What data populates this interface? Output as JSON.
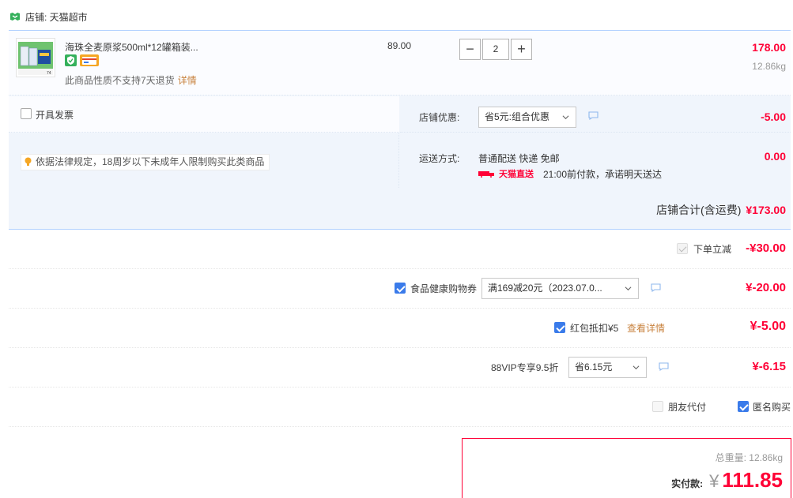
{
  "store": {
    "label": "店铺: 天猫超市"
  },
  "item": {
    "title": "海珠全麦原浆500ml*12罐箱装...",
    "unit_price": "89.00",
    "quantity": "2",
    "qty_minus": "−",
    "qty_plus": "+",
    "line_total": "178.00",
    "weight": "12.86kg",
    "return_note": "此商品性质不支持7天退货",
    "detail_link": "详情",
    "thumb_badge": "74"
  },
  "invoice": {
    "label": "开具发票"
  },
  "law_note": "依据法律规定，18周岁以下未成年人限制购买此类商品",
  "store_promo": {
    "label": "店铺优惠:",
    "selected": "省5元:组合优惠",
    "amount": "-5.00"
  },
  "shipping": {
    "label": "运送方式:",
    "method": "普通配送 快递 免邮",
    "amount": "0.00",
    "express_brand": "天猫直送",
    "promise": "21:00前付款，承诺明天送达"
  },
  "store_total": {
    "label": "店铺合计(含运费)",
    "value": "¥173.00"
  },
  "discounts": {
    "instant": {
      "label": "下单立减",
      "amount": "-¥30.00"
    },
    "coupon": {
      "label": "食品健康购物券",
      "selected": "满169减20元（2023.07.0...",
      "amount": "¥-20.00"
    },
    "redpacket": {
      "label": "红包抵扣¥5",
      "link": "查看详情",
      "amount": "¥-5.00"
    },
    "vip": {
      "label": "88VIP专享9.5折",
      "selected": "省6.15元",
      "amount": "¥-6.15"
    }
  },
  "options": {
    "friend_pay": "朋友代付",
    "anonymous": "匿名购买"
  },
  "payment": {
    "weight_label": "总重量:",
    "weight_value": "12.86kg",
    "pay_label": "实付款:",
    "currency": "¥",
    "amount": "111.85"
  },
  "colors": {
    "accent_red": "#ff0036",
    "link_orange": "#c8823e",
    "check_blue": "#3a7bea",
    "panel_blue": "#f0f5fc"
  }
}
